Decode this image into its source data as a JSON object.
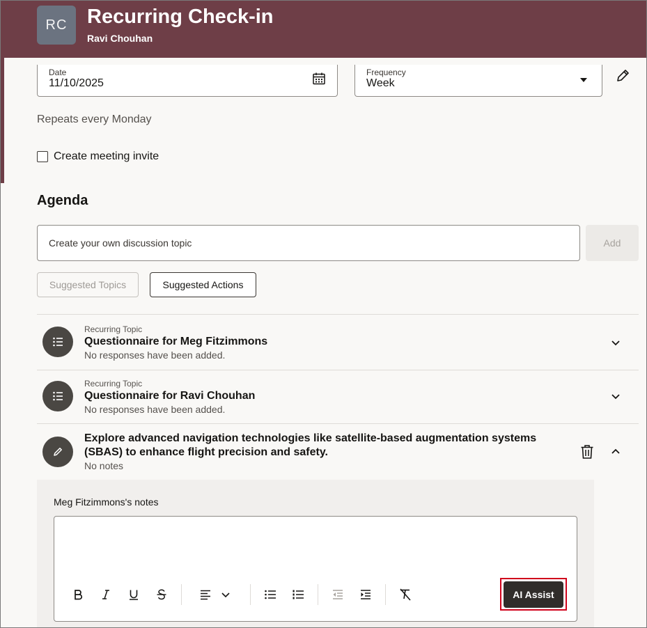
{
  "header": {
    "avatar_initials": "RC",
    "title": "Recurring Check-in",
    "subtitle": "Ravi Chouhan",
    "colors": {
      "band": "#6e3e47"
    }
  },
  "schedule": {
    "date_label": "Date",
    "date_value": "11/10/2025",
    "frequency_label": "Frequency",
    "frequency_value": "Week",
    "repeats_text": "Repeats every Monday",
    "invite_label": "Create meeting invite",
    "invite_checked": false
  },
  "agenda": {
    "heading": "Agenda",
    "topic_placeholder": "Create your own discussion topic",
    "add_label": "Add",
    "suggested_topics_label": "Suggested Topics",
    "suggested_actions_label": "Suggested Actions",
    "items": [
      {
        "kicker": "Recurring Topic",
        "title": "Questionnaire for Meg Fitzimmons",
        "subtitle": "No responses have been added."
      },
      {
        "kicker": "Recurring Topic",
        "title": "Questionnaire for Ravi Chouhan",
        "subtitle": "No responses have been added."
      },
      {
        "title_line1": "Explore advanced navigation technologies like satellite-based augmentation systems",
        "title_line2": "(SBAS) to enhance flight precision and safety.",
        "subtitle": "No notes"
      }
    ]
  },
  "notes": {
    "label": "Meg Fitzimmons's notes",
    "ai_assist_label": "AI Assist"
  }
}
